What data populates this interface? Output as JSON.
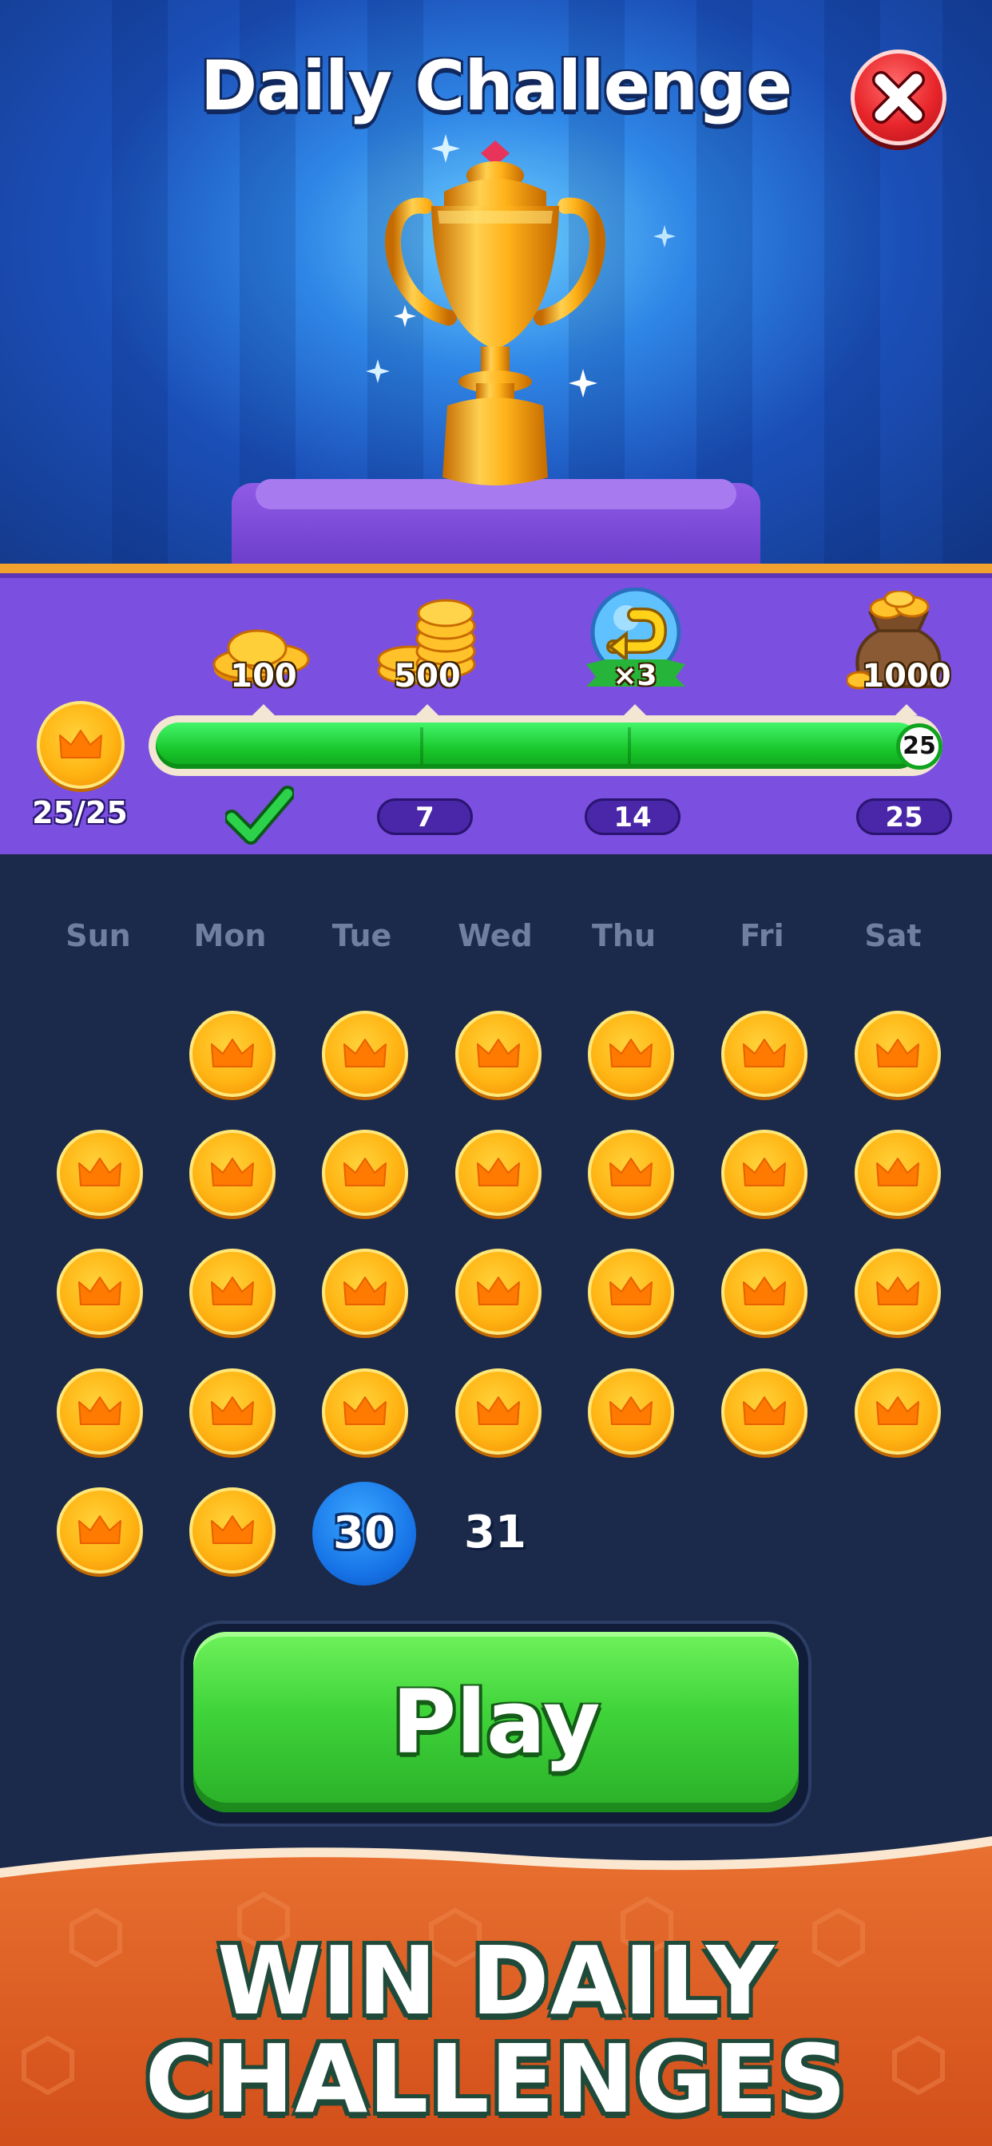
{
  "header": {
    "title": "Daily Challenge",
    "close_icon": "close-icon"
  },
  "rewards": {
    "progress_label": "25/25",
    "progress_fraction": 1.0,
    "end_badge": "25",
    "milestones": [
      {
        "reward_label": "100",
        "icon": "coin-stack-small-icon",
        "day_label": "",
        "completed": true
      },
      {
        "reward_label": "500",
        "icon": "coin-stack-large-icon",
        "day_label": "7",
        "completed": false
      },
      {
        "reward_label": "×3",
        "icon": "undo-booster-icon",
        "day_label": "14",
        "completed": false
      },
      {
        "reward_label": "1000",
        "icon": "coin-bag-icon",
        "day_label": "25",
        "completed": false
      }
    ]
  },
  "calendar": {
    "weekdays": [
      "Sun",
      "Mon",
      "Tue",
      "Wed",
      "Thu",
      "Fri",
      "Sat"
    ],
    "current_day": "30",
    "next_day": "31",
    "completed_days": 29
  },
  "play_button": {
    "label": "Play"
  },
  "banner": {
    "line1": "WIN DAILY",
    "line2": "CHALLENGES"
  },
  "colors": {
    "accent_green": "#3fd33a",
    "panel_purple": "#7b4fe0",
    "calendar_bg": "#1b2a4a",
    "today_blue": "#1672e6",
    "coin_gold": "#ffb514"
  }
}
